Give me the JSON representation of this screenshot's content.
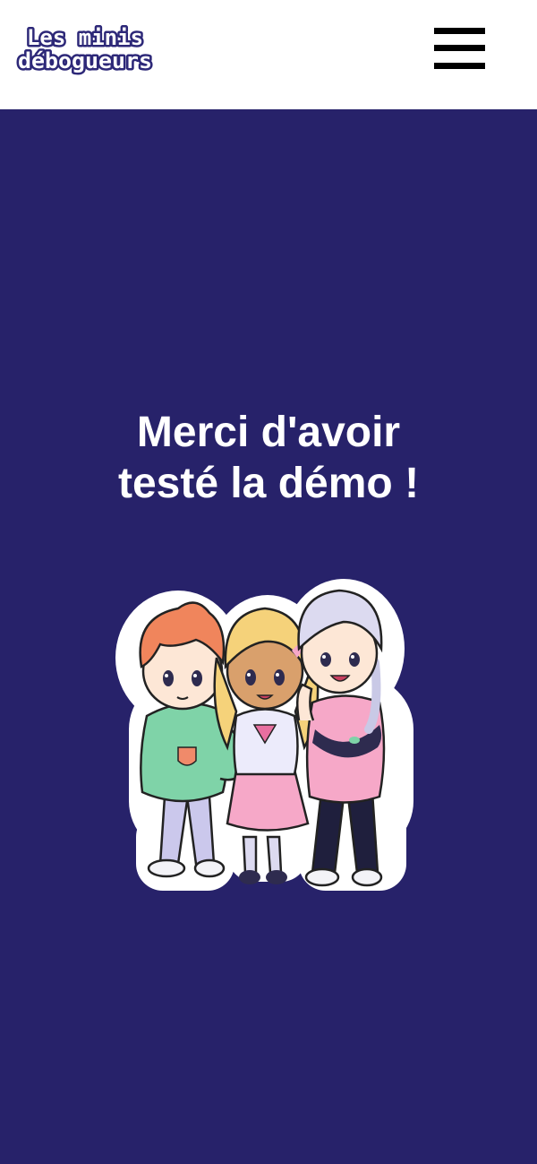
{
  "header": {
    "logo": {
      "line1": "Les minis",
      "line2": "débogueurs"
    },
    "menu_icon": "hamburger-menu-icon"
  },
  "main": {
    "title_line1": "Merci d'avoir",
    "title_line2": "testé la démo !",
    "illustration": "three-chibi-kids-illustration"
  },
  "colors": {
    "background": "#27226a",
    "header_background": "#ffffff",
    "title_text": "#ffffff",
    "logo_fill": "#ffffff",
    "logo_outline": "#2d2878"
  }
}
